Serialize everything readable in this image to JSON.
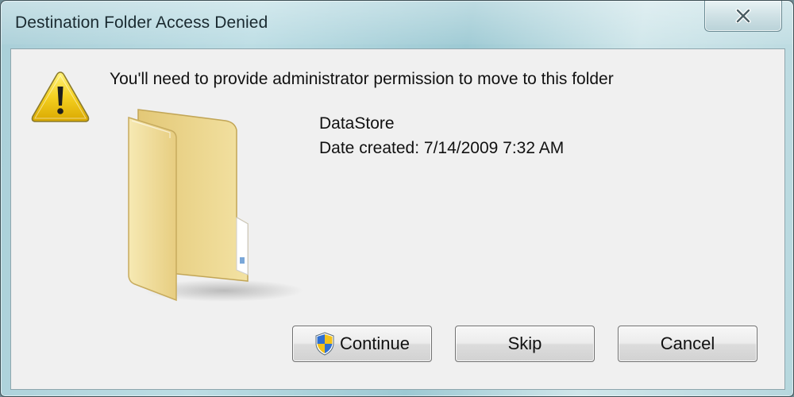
{
  "window": {
    "title": "Destination Folder Access Denied",
    "close_glyph": "✕"
  },
  "dialog": {
    "message": "You'll need to provide administrator permission to move to this folder",
    "folder_name": "DataStore",
    "date_created": "Date created: 7/14/2009 7:32 AM",
    "warning_icon": "warning-icon",
    "folder_icon": "folder-icon"
  },
  "buttons": {
    "continue_label": "Continue",
    "skip_label": "Skip",
    "cancel_label": "Cancel",
    "continue_icon": "uac-shield-icon"
  },
  "colors": {
    "titlebar": "#b6d7de",
    "client_bg": "#f0f0f0",
    "warning_yellow": "#f5d020",
    "folder_tan": "#ecd98f"
  }
}
